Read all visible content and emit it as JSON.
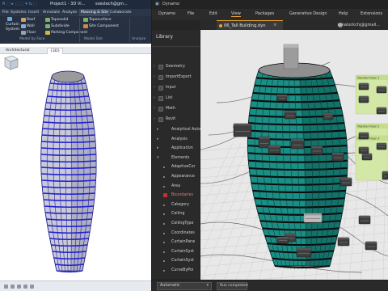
{
  "revit": {
    "title": {
      "left": "R  ⬚ ▸ ⬚ ⬚ ▾ ⇆ ⬚",
      "project": "Project1 - 3D Vi...",
      "user": "ssestech@gm..."
    },
    "menu": {
      "items": [
        "File",
        "Systems",
        "Insert",
        "Annotate",
        "Analyze",
        "Massing & Site",
        "Collaborate"
      ],
      "active": "Massing & Site"
    },
    "ribbon": {
      "row1": [
        "Roof",
        "Toposolid",
        "Toposurface"
      ],
      "row2": [
        "Wall",
        "Subdivide",
        "Site Component"
      ],
      "row3": [
        "Floor",
        "Parking Component"
      ],
      "left_labels": [
        "Curtain",
        "System"
      ],
      "panels": [
        "Model by Face",
        "Model Site",
        "Analyze"
      ]
    },
    "view_tabs": [
      {
        "label": "{3D}",
        "active": true
      },
      {
        "label": "Architectural",
        "active": false
      }
    ]
  },
  "dynamo": {
    "title": "Dynamo",
    "menu": [
      "Dynamo",
      "File",
      "Edit",
      "View",
      "Packages",
      "Generative Design",
      "Help",
      "Extensions"
    ],
    "active_menu": "View",
    "user": "ssnalockchj@gmail...",
    "file_tab": "06_Tall Building.dyn",
    "library_title": "Library",
    "library_items": [
      {
        "label": "Geometry",
        "level": 0,
        "kind": "category"
      },
      {
        "label": "ImportExport",
        "level": 0,
        "kind": "category"
      },
      {
        "label": "Input",
        "level": 0,
        "kind": "category"
      },
      {
        "label": "List",
        "level": 0,
        "kind": "category"
      },
      {
        "label": "Math",
        "level": 0,
        "kind": "category"
      },
      {
        "label": "Revit",
        "level": 0,
        "kind": "category"
      },
      {
        "label": "Analytical Automa",
        "level": 1,
        "kind": "group"
      },
      {
        "label": "Analysis",
        "level": 1,
        "kind": "group"
      },
      {
        "label": "Application",
        "level": 1,
        "kind": "group"
      },
      {
        "label": "Elements",
        "level": 1,
        "kind": "group-open"
      },
      {
        "label": "AdaptiveCor",
        "level": 2,
        "kind": "item"
      },
      {
        "label": "Appearance",
        "level": 2,
        "kind": "item"
      },
      {
        "label": "Area",
        "level": 2,
        "kind": "item"
      },
      {
        "label": "Boundaries",
        "level": 2,
        "kind": "item-tag"
      },
      {
        "label": "Category",
        "level": 2,
        "kind": "item"
      },
      {
        "label": "Ceiling",
        "level": 2,
        "kind": "item"
      },
      {
        "label": "CeilingType",
        "level": 2,
        "kind": "item"
      },
      {
        "label": "Coordinates",
        "level": 2,
        "kind": "item"
      },
      {
        "label": "CurtainPane",
        "level": 2,
        "kind": "item"
      },
      {
        "label": "CurtainSyst",
        "level": 2,
        "kind": "item"
      },
      {
        "label": "CurtainSyst",
        "level": 2,
        "kind": "item"
      },
      {
        "label": "CurveByPoi",
        "level": 2,
        "kind": "item"
      }
    ],
    "groups": [
      "Transfer Floor 1",
      "Transfer Floor 2",
      "Transfer Floor 3"
    ],
    "run_mode": "Automatic",
    "run_status": "Run completed"
  }
}
